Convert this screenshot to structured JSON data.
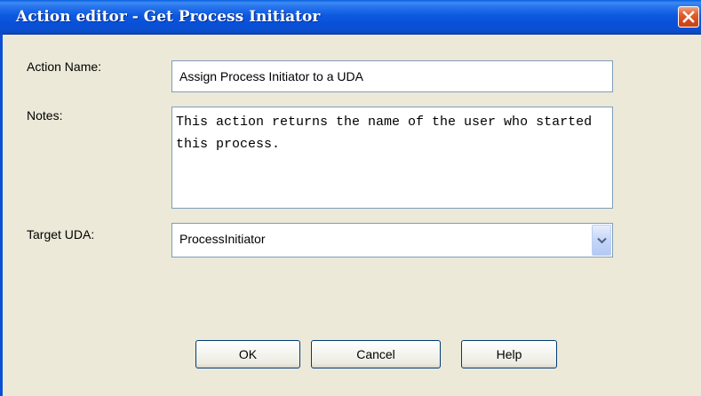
{
  "window": {
    "title": "Action editor - Get Process Initiator",
    "close_icon": "close-x-icon"
  },
  "form": {
    "action_name_label": "Action Name:",
    "action_name_value": "Assign Process Initiator to a UDA",
    "notes_label": "Notes:",
    "notes_value": "This action returns the name of the user who started this process.",
    "target_uda_label": "Target UDA:",
    "target_uda_value": "ProcessInitiator",
    "dropdown_icon": "chevron-down-icon"
  },
  "buttons": {
    "ok_label": "OK",
    "cancel_label": "Cancel",
    "help_label": "Help"
  },
  "colors": {
    "titlebar": "#0a5fe0",
    "close": "#e2612f",
    "face": "#ece9d8",
    "field_border": "#7f9db9"
  }
}
